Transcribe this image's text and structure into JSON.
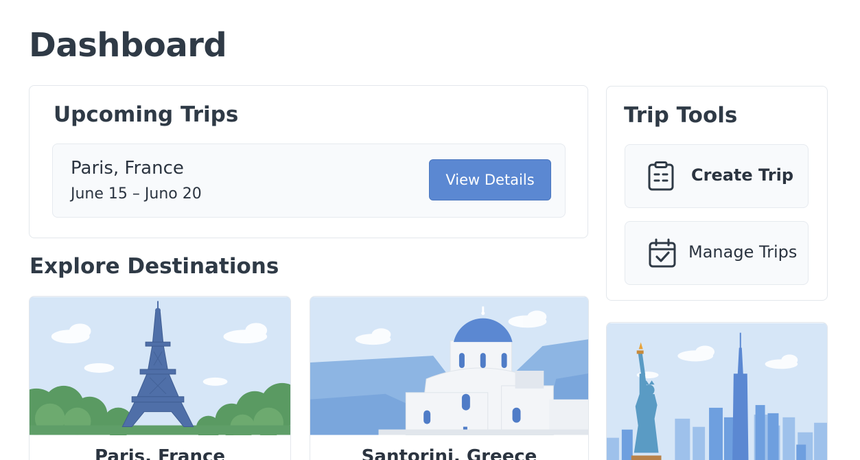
{
  "page": {
    "title": "Dashboard"
  },
  "upcoming": {
    "heading": "Upcoming Trips",
    "trips": [
      {
        "name": "Paris, France",
        "dates": "June 15 – Juno 20",
        "action_label": "View Details"
      }
    ]
  },
  "tools": {
    "heading": "Trip Tools",
    "items": [
      {
        "label": "Create Trip",
        "icon": "clipboard-list-icon"
      },
      {
        "label": "Manage Trips",
        "icon": "calendar-check-icon"
      }
    ]
  },
  "explore": {
    "heading": "Explore Destinations",
    "destinations": [
      {
        "name": "Paris, France",
        "image": "eiffel-tower-illustration"
      },
      {
        "name": "Santorini, Greece",
        "image": "santorini-church-illustration"
      },
      {
        "name": "",
        "image": "new-york-statue-of-liberty-illustration"
      }
    ]
  },
  "colors": {
    "accent": "#5b88d2",
    "text": "#2f3a46",
    "sky": "#d3e4f6",
    "green": "#5f9e68"
  }
}
